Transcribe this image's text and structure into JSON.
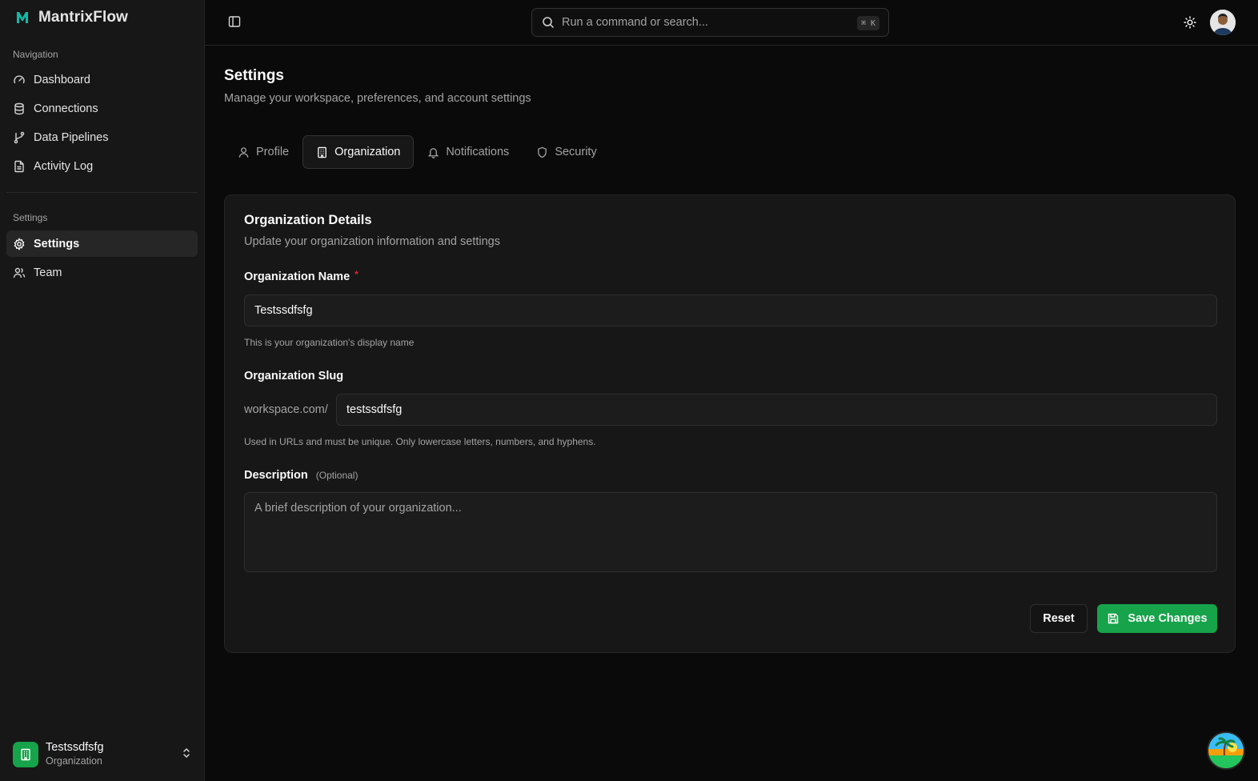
{
  "app": {
    "name": "MantrixFlow",
    "accent": "#14b8a6"
  },
  "sidebar": {
    "nav_label": "Navigation",
    "nav_items": [
      {
        "label": "Dashboard",
        "icon": "gauge-icon"
      },
      {
        "label": "Connections",
        "icon": "database-icon"
      },
      {
        "label": "Data Pipelines",
        "icon": "git-branch-icon"
      },
      {
        "label": "Activity Log",
        "icon": "file-text-icon"
      }
    ],
    "settings_label": "Settings",
    "settings_items": [
      {
        "label": "Settings",
        "icon": "gear-icon",
        "active": true
      },
      {
        "label": "Team",
        "icon": "users-icon"
      }
    ],
    "org": {
      "name": "Testssdfsfg",
      "role": "Organization",
      "color": "#16a34a"
    }
  },
  "topbar": {
    "search_placeholder": "Run a command or search...",
    "shortcut": "⌘ K"
  },
  "page": {
    "title": "Settings",
    "subtitle": "Manage your workspace, preferences, and account settings"
  },
  "tabs": [
    {
      "label": "Profile",
      "icon": "user-icon"
    },
    {
      "label": "Organization",
      "icon": "building-icon",
      "active": true
    },
    {
      "label": "Notifications",
      "icon": "bell-icon"
    },
    {
      "label": "Security",
      "icon": "shield-icon"
    }
  ],
  "card": {
    "title": "Organization Details",
    "description": "Update your organization information and settings",
    "org_name": {
      "label": "Organization Name",
      "required_mark": "*",
      "value": "Testssdfsfg",
      "help": "This is your organization's display name"
    },
    "org_slug": {
      "label": "Organization Slug",
      "prefix": "workspace.com/",
      "value": "testssdfsfg",
      "help": "Used in URLs and must be unique. Only lowercase letters, numbers, and hyphens."
    },
    "description_field": {
      "label": "Description",
      "optional": "(Optional)",
      "placeholder": "A brief description of your organization..."
    },
    "reset_label": "Reset",
    "save_label": "Save Changes",
    "save_color": "#16a34a"
  }
}
